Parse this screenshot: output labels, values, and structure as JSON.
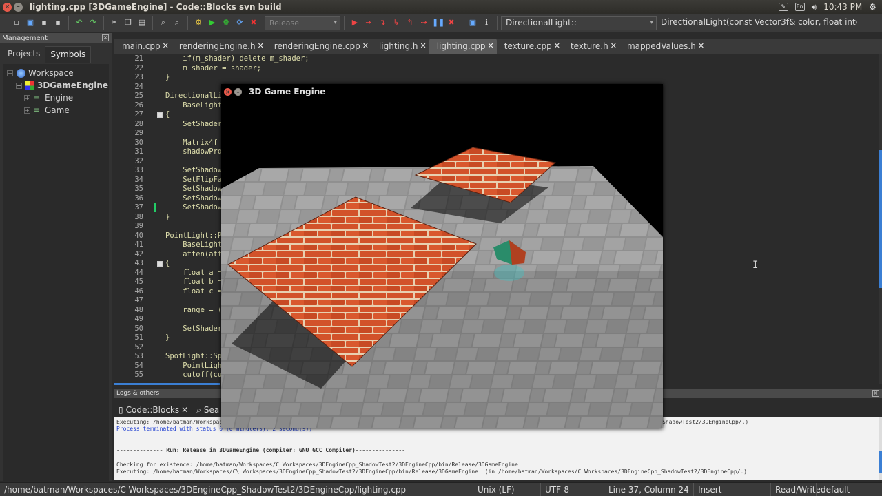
{
  "titlebar": {
    "title": "lighting.cpp [3DGameEngine] - Code::Blocks svn build",
    "lang": "En",
    "clock": "10:43 PM"
  },
  "toolbar": {
    "build_target": "Release",
    "scope": "DirectionalLight::",
    "function": "DirectionalLight(const Vector3f& color, float intensi"
  },
  "management": {
    "title": "Management",
    "tabs": [
      "Projects",
      "Symbols"
    ],
    "tree": {
      "workspace": "Workspace",
      "project": "3DGameEngine",
      "folders": [
        "Engine",
        "Game"
      ]
    }
  },
  "editor_tabs": [
    "main.cpp",
    "renderingEngine.h",
    "renderingEngine.cpp",
    "lighting.h",
    "lighting.cpp",
    "texture.cpp",
    "texture.h",
    "mappedValues.h"
  ],
  "active_tab": "lighting.cpp",
  "code_lines": [
    {
      "n": "21",
      "text": "    if(m_shader) delete m_shader;"
    },
    {
      "n": "22",
      "text": "    m_shader = shader;"
    },
    {
      "n": "23",
      "text": "}"
    },
    {
      "n": "24",
      "text": ""
    },
    {
      "n": "25",
      "text": "DirectionalLi"
    },
    {
      "n": "26",
      "text": "    BaseLight"
    },
    {
      "n": "27",
      "text": "{"
    },
    {
      "n": "28",
      "text": "    SetShader"
    },
    {
      "n": "29",
      "text": ""
    },
    {
      "n": "30",
      "text": "    Matrix4f"
    },
    {
      "n": "31",
      "text": "    shadowPro"
    },
    {
      "n": "32",
      "text": ""
    },
    {
      "n": "33",
      "text": "    SetShadow"
    },
    {
      "n": "34",
      "text": "    SetFlipFa"
    },
    {
      "n": "35",
      "text": "    SetShadow"
    },
    {
      "n": "36",
      "text": "    SetShadow"
    },
    {
      "n": "37",
      "text": "    SetShadow"
    },
    {
      "n": "38",
      "text": "}"
    },
    {
      "n": "39",
      "text": ""
    },
    {
      "n": "40",
      "text": "PointLight::P"
    },
    {
      "n": "41",
      "text": "    BaseLight"
    },
    {
      "n": "42",
      "text": "    atten(att"
    },
    {
      "n": "43",
      "text": "{"
    },
    {
      "n": "44",
      "text": "    float a ="
    },
    {
      "n": "45",
      "text": "    float b ="
    },
    {
      "n": "46",
      "text": "    float c ="
    },
    {
      "n": "47",
      "text": ""
    },
    {
      "n": "48",
      "text": "    range = ("
    },
    {
      "n": "49",
      "text": ""
    },
    {
      "n": "50",
      "text": "    SetShader"
    },
    {
      "n": "51",
      "text": "}"
    },
    {
      "n": "52",
      "text": ""
    },
    {
      "n": "53",
      "text": "SpotLight::Sp"
    },
    {
      "n": "54",
      "text": "    PointLigh"
    },
    {
      "n": "55",
      "text": "    cutoff(cu"
    }
  ],
  "logs": {
    "title": "Logs & others",
    "tabs": [
      "Code::Blocks",
      "Sea"
    ],
    "lines": [
      {
        "text": "Executing: /home/batman/Workspac",
        "style": "normal",
        "after": "ShadowTest2/3DEngineCpp/.)"
      },
      {
        "text": "Process terminated with status 0 (0 minute(s), 2 second(s))",
        "style": "blue",
        "after": ""
      },
      {
        "text": "",
        "style": "normal",
        "after": ""
      },
      {
        "text": "",
        "style": "normal",
        "after": ""
      },
      {
        "text": "-------------- Run: Release in 3DGameEngine (compiler: GNU GCC Compiler)---------------",
        "style": "bold",
        "after": ""
      },
      {
        "text": "",
        "style": "normal",
        "after": ""
      },
      {
        "text": "Checking for existence: /home/batman/Workspaces/C Workspaces/3DEngineCpp_ShadowTest2/3DEngineCpp/bin/Release/3DGameEngine",
        "style": "normal",
        "after": ""
      },
      {
        "text": "Executing: /home/batman/Workspaces/C\\ Workspaces/3DEngineCpp_ShadowTest2/3DEngineCpp/bin/Release/3DGameEngine  (in /home/batman/Workspaces/C Workspaces/3DEngineCpp_ShadowTest2/3DEngineCpp/.)",
        "style": "normal",
        "after": ""
      }
    ]
  },
  "status": {
    "path": "/home/batman/Workspaces/C Workspaces/3DEngineCpp_ShadowTest2/3DEngineCpp/lighting.cpp",
    "eol": "Unix (LF)",
    "encoding": "UTF-8",
    "position": "Line 37, Column 24",
    "mode": "Insert",
    "rw": "Read/Write",
    "profile": "default"
  },
  "game_window": {
    "title": "3D Game Engine"
  },
  "colors": {
    "accent": "#3b7fd4",
    "brick": "#d2522a",
    "stone": "#8a8a8a"
  }
}
